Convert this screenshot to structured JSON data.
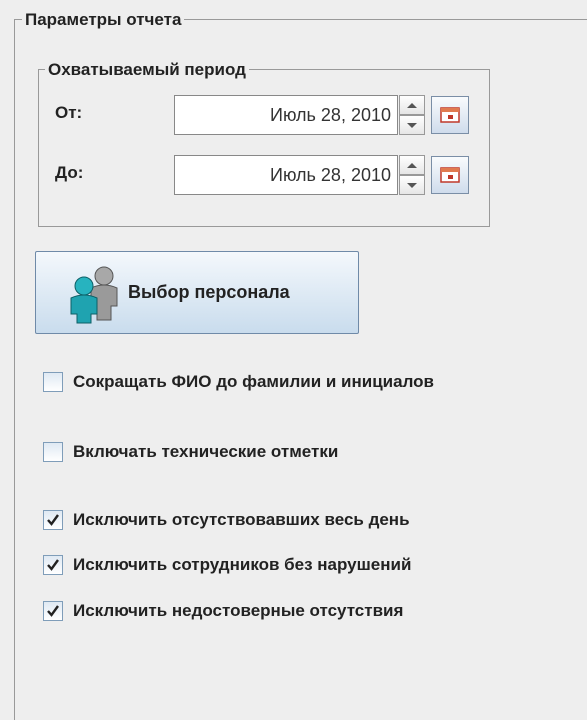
{
  "report_params": {
    "legend": "Параметры отчета",
    "period": {
      "legend": "Охватываемый период",
      "from_label": "От:",
      "from_value": "Июль 28, 2010",
      "to_label": "До:",
      "to_value": "Июль 28, 2010"
    },
    "staff_button_label": "Выбор персонала",
    "options": [
      {
        "label": "Сокращать ФИО до фамилии и инициалов",
        "checked": false
      },
      {
        "label": "Включать технические отметки",
        "checked": false
      },
      {
        "label": "Исключить отсутствовавших весь день",
        "checked": true
      },
      {
        "label": "Исключить сотрудников без нарушений",
        "checked": true
      },
      {
        "label": "Исключить недостоверные отсутствия",
        "checked": true
      }
    ]
  },
  "icons": {
    "spinner_up": "spinner-up-icon",
    "spinner_down": "spinner-down-icon",
    "calendar": "calendar-icon",
    "staff": "people-icon",
    "check": "checkmark-icon"
  },
  "colors": {
    "background": "#eeeeee",
    "button_gradient_top": "#f4f8fc",
    "button_gradient_bottom": "#c9dced",
    "staff_icon_primary": "#1fa3b0",
    "staff_icon_secondary": "#9a9a9a"
  }
}
